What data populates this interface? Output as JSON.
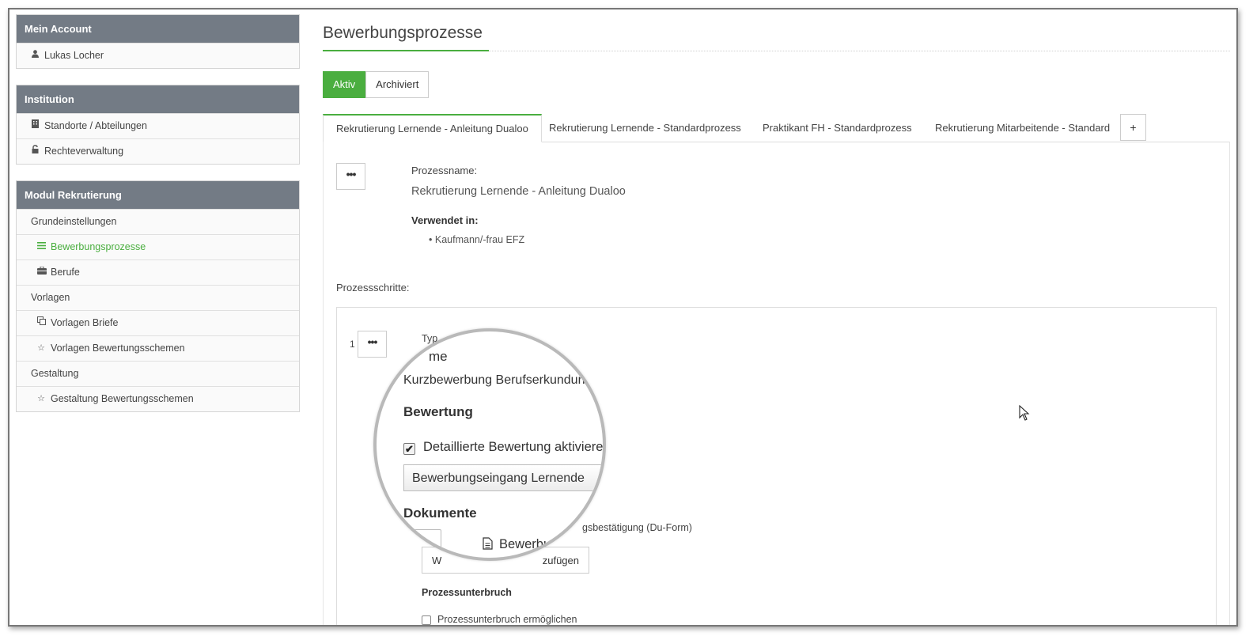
{
  "sidebar": {
    "account": {
      "title": "Mein Account",
      "user": "Lukas Locher",
      "user_icon": "user-icon"
    },
    "institution": {
      "title": "Institution",
      "items": [
        {
          "label": "Standorte / Abteilungen",
          "icon": "building-icon"
        },
        {
          "label": "Rechteverwaltung",
          "icon": "unlock-icon"
        }
      ]
    },
    "rekrutierung": {
      "title": "Modul Rekrutierung",
      "section_basic": "Grundeinstellungen",
      "processes": "Bewerbungsprozesse",
      "jobs": "Berufe",
      "section_templates": "Vorlagen",
      "letter_templates": "Vorlagen Briefe",
      "rating_templates": "Vorlagen Bewertungsschemen",
      "section_design": "Gestaltung",
      "rating_design": "Gestaltung Bewertungsschemen"
    }
  },
  "main": {
    "title": "Bewerbungsprozesse",
    "filter": {
      "active": "Aktiv",
      "archived": "Archiviert"
    },
    "tabs": [
      "Rekrutierung Lernende - Anleitung Dualoo",
      "Rekrutierung Lernende - Standardprozess",
      "Praktikant FH - Standardprozess",
      "Rekrutierung Mitarbeitende - Standard"
    ],
    "add_tab": "+",
    "menu_dots": "•••",
    "process_name_label": "Prozessname:",
    "process_name": "Rekrutierung Lernende - Anleitung Dualoo",
    "used_in_label": "Verwendet in:",
    "used_in": [
      "Kaufmann/-frau EFZ"
    ],
    "steps_label": "Prozessschritte:",
    "step": {
      "number": "1",
      "type_label": "Typ",
      "doc_partial": "gsbestätigung (Du-Form)",
      "add_doc_left": "W",
      "add_doc_right": "zufügen",
      "interrupt_label": "Prozessunterbruch",
      "interrupt_check": "Prozessunterbruch ermöglichen"
    }
  },
  "magnifier": {
    "name_partial": "me",
    "name_value": "Kurzbewerbung Berufserkundun",
    "rating_heading": "Bewertung",
    "detail_check": "Detaillierte Bewertung aktivieren",
    "detail_checked": true,
    "check_mark": "✔",
    "scheme_select": "Bewerbungseingang Lernende",
    "documents_heading": "Dokumente",
    "document_partial": "Bewerbun"
  }
}
